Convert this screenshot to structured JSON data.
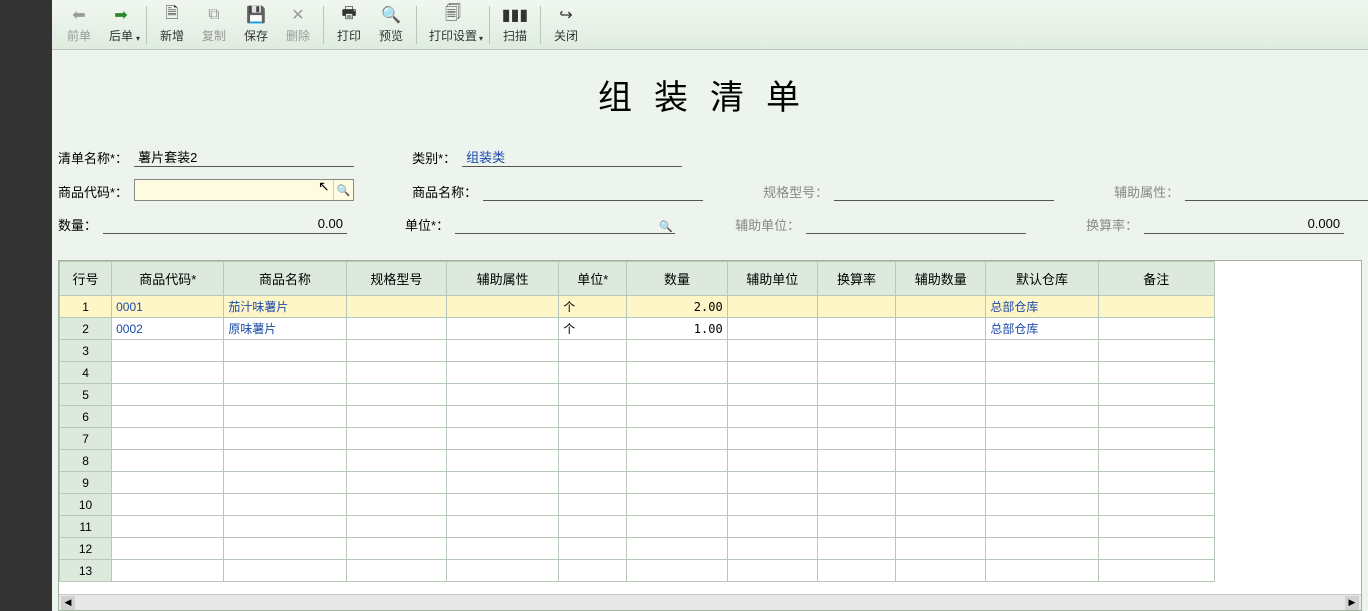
{
  "toolbar": {
    "prev": "前单",
    "next": "后单",
    "new": "新增",
    "copy": "复制",
    "save": "保存",
    "delete": "删除",
    "print": "打印",
    "preview": "预览",
    "print_settings": "打印设置",
    "scan": "扫描",
    "close": "关闭"
  },
  "title": "组装清单",
  "form": {
    "list_name_label": "清单名称*：",
    "list_name": "薯片套装2",
    "category_label": "类别*：",
    "category": "组装类",
    "product_code_label": "商品代码*：",
    "product_code": "",
    "product_name_label": "商品名称：",
    "product_name": "",
    "spec_label": "规格型号：",
    "spec": "",
    "aux_attr_label": "辅助属性：",
    "aux_attr": "",
    "qty_label": "数量：",
    "qty": "0.00",
    "unit_label": "单位*：",
    "unit": "",
    "aux_unit_label": "辅助单位：",
    "aux_unit": "",
    "rate_label": "换算率：",
    "rate": "0.000"
  },
  "grid": {
    "headers": {
      "rownum": "行号",
      "code": "商品代码*",
      "name": "商品名称",
      "spec": "规格型号",
      "aux_attr": "辅助属性",
      "unit": "单位*",
      "qty": "数量",
      "aux_unit": "辅助单位",
      "rate": "换算率",
      "aux_qty": "辅助数量",
      "warehouse": "默认仓库",
      "remark": "备注"
    },
    "rows": [
      {
        "n": "1",
        "code": "0001",
        "name": "茄汁味薯片",
        "spec": "",
        "aux_attr": "",
        "unit": "个",
        "qty": "2.00",
        "aux_unit": "",
        "rate": "",
        "aux_qty": "",
        "warehouse": "总部仓库",
        "remark": ""
      },
      {
        "n": "2",
        "code": "0002",
        "name": "原味薯片",
        "spec": "",
        "aux_attr": "",
        "unit": "个",
        "qty": "1.00",
        "aux_unit": "",
        "rate": "",
        "aux_qty": "",
        "warehouse": "总部仓库",
        "remark": ""
      },
      {
        "n": "3",
        "code": "",
        "name": "",
        "spec": "",
        "aux_attr": "",
        "unit": "",
        "qty": "",
        "aux_unit": "",
        "rate": "",
        "aux_qty": "",
        "warehouse": "",
        "remark": ""
      },
      {
        "n": "4",
        "code": "",
        "name": "",
        "spec": "",
        "aux_attr": "",
        "unit": "",
        "qty": "",
        "aux_unit": "",
        "rate": "",
        "aux_qty": "",
        "warehouse": "",
        "remark": ""
      },
      {
        "n": "5",
        "code": "",
        "name": "",
        "spec": "",
        "aux_attr": "",
        "unit": "",
        "qty": "",
        "aux_unit": "",
        "rate": "",
        "aux_qty": "",
        "warehouse": "",
        "remark": ""
      },
      {
        "n": "6",
        "code": "",
        "name": "",
        "spec": "",
        "aux_attr": "",
        "unit": "",
        "qty": "",
        "aux_unit": "",
        "rate": "",
        "aux_qty": "",
        "warehouse": "",
        "remark": ""
      },
      {
        "n": "7",
        "code": "",
        "name": "",
        "spec": "",
        "aux_attr": "",
        "unit": "",
        "qty": "",
        "aux_unit": "",
        "rate": "",
        "aux_qty": "",
        "warehouse": "",
        "remark": ""
      },
      {
        "n": "8",
        "code": "",
        "name": "",
        "spec": "",
        "aux_attr": "",
        "unit": "",
        "qty": "",
        "aux_unit": "",
        "rate": "",
        "aux_qty": "",
        "warehouse": "",
        "remark": ""
      },
      {
        "n": "9",
        "code": "",
        "name": "",
        "spec": "",
        "aux_attr": "",
        "unit": "",
        "qty": "",
        "aux_unit": "",
        "rate": "",
        "aux_qty": "",
        "warehouse": "",
        "remark": ""
      },
      {
        "n": "10",
        "code": "",
        "name": "",
        "spec": "",
        "aux_attr": "",
        "unit": "",
        "qty": "",
        "aux_unit": "",
        "rate": "",
        "aux_qty": "",
        "warehouse": "",
        "remark": ""
      },
      {
        "n": "11",
        "code": "",
        "name": "",
        "spec": "",
        "aux_attr": "",
        "unit": "",
        "qty": "",
        "aux_unit": "",
        "rate": "",
        "aux_qty": "",
        "warehouse": "",
        "remark": ""
      },
      {
        "n": "12",
        "code": "",
        "name": "",
        "spec": "",
        "aux_attr": "",
        "unit": "",
        "qty": "",
        "aux_unit": "",
        "rate": "",
        "aux_qty": "",
        "warehouse": "",
        "remark": ""
      },
      {
        "n": "13",
        "code": "",
        "name": "",
        "spec": "",
        "aux_attr": "",
        "unit": "",
        "qty": "",
        "aux_unit": "",
        "rate": "",
        "aux_qty": "",
        "warehouse": "",
        "remark": ""
      }
    ]
  }
}
